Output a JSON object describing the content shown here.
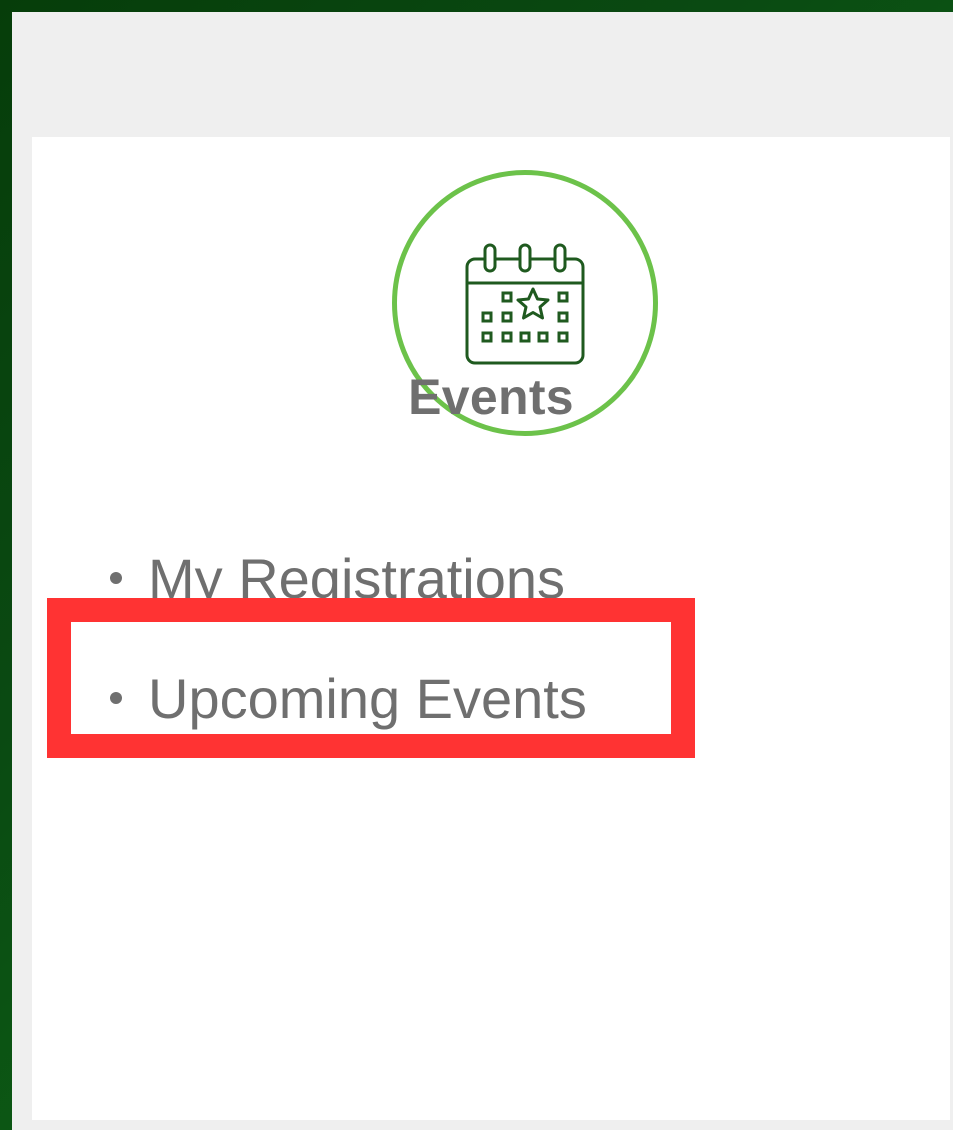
{
  "card": {
    "icon": "calendar-star-icon",
    "title": "Events"
  },
  "menu": {
    "items": [
      {
        "label": "My Registrations"
      },
      {
        "label": "Upcoming Events"
      }
    ]
  },
  "colors": {
    "accent_green": "#6cc24a",
    "icon_dark_green": "#1f5a1f",
    "text_gray": "#6f6f6f",
    "highlight_red": "#ff3333",
    "background_green": "#0a4a12"
  }
}
